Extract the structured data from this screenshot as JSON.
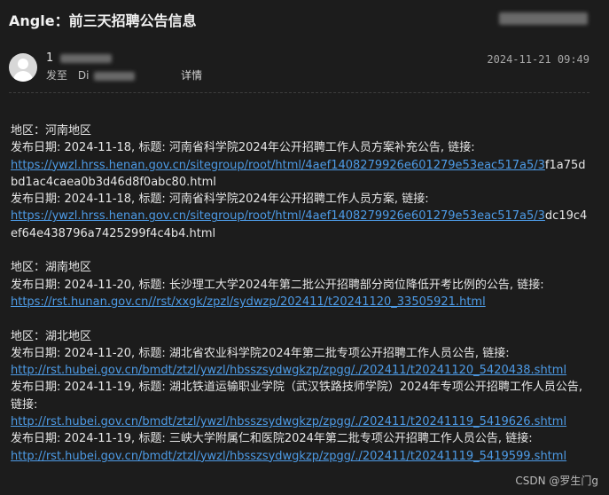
{
  "email": {
    "subject": "Angle：前三天招聘公告信息",
    "sender": "1",
    "to_label": "发至",
    "to_value": "Di",
    "details_label": "详情",
    "timestamp": "2024-11-21 09:49"
  },
  "regions": [
    {
      "heading": "地区：河南地区",
      "items": [
        {
          "text": "发布日期: 2024-11-18, 标题: 河南省科学院2024年公开招聘工作人员方案补充公告, 链接:",
          "link": "https://ywzl.hrss.henan.gov.cn/sitegroup/root/html/4aef1408279926e601279e53eac517a5/3",
          "tail": "f1a75dbd1ac4caea0b3d46d8f0abc80.html"
        },
        {
          "text": "发布日期: 2024-11-18, 标题: 河南省科学院2024年公开招聘工作人员方案, 链接:",
          "link": "https://ywzl.hrss.henan.gov.cn/sitegroup/root/html/4aef1408279926e601279e53eac517a5/3",
          "tail": "dc19c4ef64e438796a7425299f4c4b4.html"
        }
      ]
    },
    {
      "heading": "地区：湖南地区",
      "items": [
        {
          "text": "发布日期: 2024-11-20, 标题: 长沙理工大学2024年第二批公开招聘部分岗位降低开考比例的公告, 链接:",
          "link": "https://rst.hunan.gov.cn//rst/xxgk/zpzl/sydwzp/202411/t20241120_33505921.html",
          "tail": ""
        }
      ]
    },
    {
      "heading": "地区：湖北地区",
      "items": [
        {
          "text": "发布日期: 2024-11-20, 标题: 湖北省农业科学院2024年第二批专项公开招聘工作人员公告, 链接:",
          "link": "http://rst.hubei.gov.cn/bmdt/ztzl/ywzl/hbsszsydwgkzp/zpgg/./202411/t20241120_5420438.shtml",
          "tail": ""
        },
        {
          "text": "发布日期: 2024-11-19, 标题: 湖北铁道运输职业学院（武汉铁路技师学院）2024年专项公开招聘工作人员公告, 链接:",
          "link": "http://rst.hubei.gov.cn/bmdt/ztzl/ywzl/hbsszsydwgkzp/zpgg/./202411/t20241119_5419626.shtml",
          "tail": ""
        },
        {
          "text": "发布日期: 2024-11-19, 标题: 三峡大学附属仁和医院2024年第二批专项公开招聘工作人员公告, 链接:",
          "link": "http://rst.hubei.gov.cn/bmdt/ztzl/ywzl/hbsszsydwgkzp/zpgg/./202411/t20241119_5419599.shtml",
          "tail": ""
        }
      ]
    }
  ],
  "watermark": "CSDN @罗生门g"
}
